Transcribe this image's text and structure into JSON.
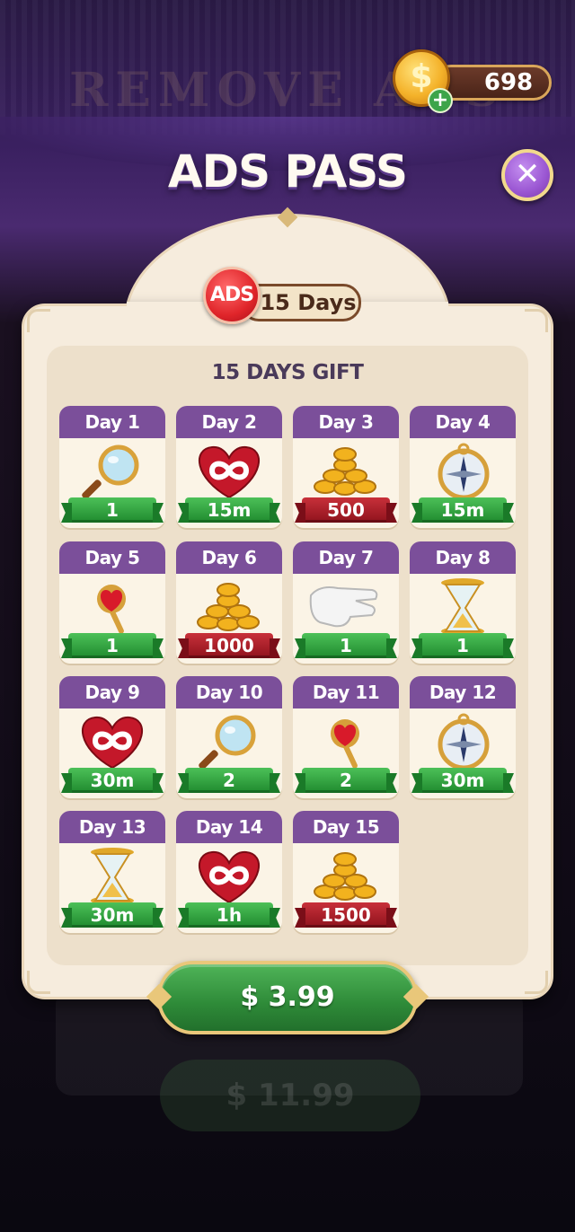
{
  "background": {
    "ghost_title": "REMOVE ADS",
    "ghost_button": "$ 11.99"
  },
  "currency": {
    "coins": "698",
    "coin_symbol": "$",
    "add_symbol": "+"
  },
  "title": "ADS PASS",
  "close_symbol": "✕",
  "badge": {
    "ads_label": "ADS",
    "duration": "15 Days"
  },
  "gift_title": "15 DAYS GIFT",
  "days": [
    {
      "label": "Day 1",
      "reward": "1",
      "item": "magnifier",
      "ribbon": "green"
    },
    {
      "label": "Day 2",
      "reward": "15m",
      "item": "infinite-heart",
      "ribbon": "green"
    },
    {
      "label": "Day 3",
      "reward": "500",
      "item": "coins",
      "ribbon": "red"
    },
    {
      "label": "Day 4",
      "reward": "15m",
      "item": "compass",
      "ribbon": "green"
    },
    {
      "label": "Day 5",
      "reward": "1",
      "item": "ruby-wand",
      "ribbon": "green"
    },
    {
      "label": "Day 6",
      "reward": "1000",
      "item": "coins",
      "ribbon": "red"
    },
    {
      "label": "Day 7",
      "reward": "1",
      "item": "glove",
      "ribbon": "green"
    },
    {
      "label": "Day 8",
      "reward": "1",
      "item": "hourglass",
      "ribbon": "green"
    },
    {
      "label": "Day 9",
      "reward": "30m",
      "item": "infinite-heart",
      "ribbon": "green"
    },
    {
      "label": "Day 10",
      "reward": "2",
      "item": "magnifier",
      "ribbon": "green"
    },
    {
      "label": "Day 11",
      "reward": "2",
      "item": "ruby-wand",
      "ribbon": "green"
    },
    {
      "label": "Day 12",
      "reward": "30m",
      "item": "compass",
      "ribbon": "green"
    },
    {
      "label": "Day 13",
      "reward": "30m",
      "item": "hourglass",
      "ribbon": "green"
    },
    {
      "label": "Day 14",
      "reward": "1h",
      "item": "infinite-heart",
      "ribbon": "green"
    },
    {
      "label": "Day 15",
      "reward": "1500",
      "item": "coins",
      "ribbon": "red"
    }
  ],
  "price_button": "$ 3.99"
}
